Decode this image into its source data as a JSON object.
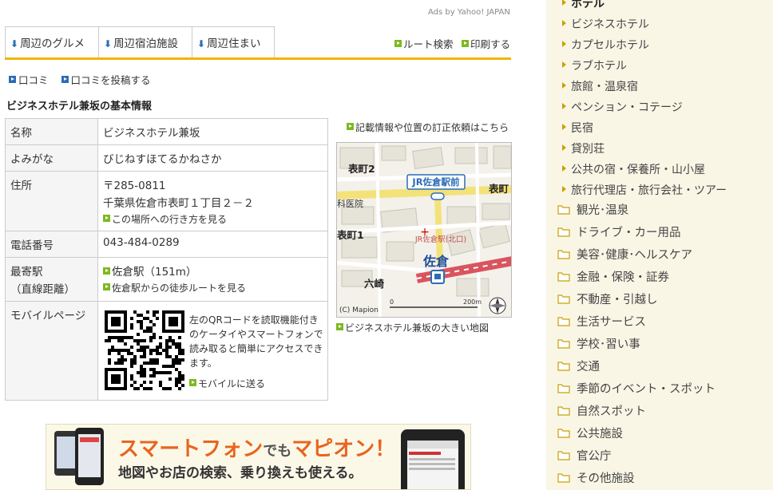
{
  "ads_credit": "Ads by Yahoo! JAPAN",
  "tabs": [
    {
      "label": "周辺のグルメ"
    },
    {
      "label": "周辺宿泊施設"
    },
    {
      "label": "周辺住まい"
    }
  ],
  "header_links": {
    "route": "ルート検索",
    "print": "印刷する"
  },
  "review_links": {
    "reviews": "口コミ",
    "post_review": "口コミを投稿する"
  },
  "section_title": "ビジネスホテル兼坂の基本情報",
  "info": {
    "name_label": "名称",
    "name": "ビジネスホテル兼坂",
    "reading_label": "よみがな",
    "reading": "びじねすほてるかねさか",
    "address_label": "住所",
    "postal": "〒285-0811",
    "address": "千葉県佐倉市表町１丁目２－２",
    "directions_link": "この場所への行き方を見る",
    "phone_label": "電話番号",
    "phone": "043-484-0289",
    "station_label_1": "最寄駅",
    "station_label_2": "（直線距離）",
    "station": "佐倉駅（151m）",
    "walk_route_link": "佐倉駅からの徒歩ルートを見る",
    "mobile_label": "モバイルページ",
    "qr_text": "左のQRコードを読取機能付きのケータイやスマートフォンで読み取ると簡単にアクセスできます。",
    "send_mobile_link": "モバイルに送る"
  },
  "correction_link": "記載情報や位置の訂正依頼はこちら",
  "map": {
    "labels": {
      "omotemachi2": "表町2",
      "omotemachi1": "表町1",
      "omotemachi": "表町",
      "jr_station_front": "JR佐倉駅前",
      "hospital": "科医院",
      "sakura": "佐倉",
      "jr_north_exit": "JR佐倉駅(北口)",
      "rokuzaki": "六崎",
      "copyright": "(C) Mapion",
      "scale": "200m",
      "scale_zero": "0"
    },
    "large_map_link": "ビジネスホテル兼坂の大きい地図"
  },
  "banner": {
    "title_part1": "スマートフォン",
    "title_part2": "でも",
    "title_part3": "マピオン！",
    "subtitle": "地図やお店の検索、乗り換えも使える。"
  },
  "sidebar": {
    "subcategories": [
      {
        "label": "ホテル",
        "current": true
      },
      {
        "label": "ビジネスホテル"
      },
      {
        "label": "カプセルホテル"
      },
      {
        "label": "ラブホテル"
      },
      {
        "label": "旅館・温泉宿"
      },
      {
        "label": "ペンション・コテージ"
      },
      {
        "label": "民宿"
      },
      {
        "label": "貸別荘"
      },
      {
        "label": "公共の宿・保養所・山小屋"
      },
      {
        "label": "旅行代理店・旅行会社・ツアー"
      }
    ],
    "categories": [
      {
        "label": "観光･温泉"
      },
      {
        "label": "ドライブ・カー用品"
      },
      {
        "label": "美容･健康･ヘルスケア"
      },
      {
        "label": "金融・保険・証券"
      },
      {
        "label": "不動産・引越し"
      },
      {
        "label": "生活サービス"
      },
      {
        "label": "学校･習い事"
      },
      {
        "label": "交通"
      },
      {
        "label": "季節のイベント・スポット"
      },
      {
        "label": "自然スポット"
      },
      {
        "label": "公共施設"
      },
      {
        "label": "官公庁"
      },
      {
        "label": "その他施設"
      }
    ]
  }
}
